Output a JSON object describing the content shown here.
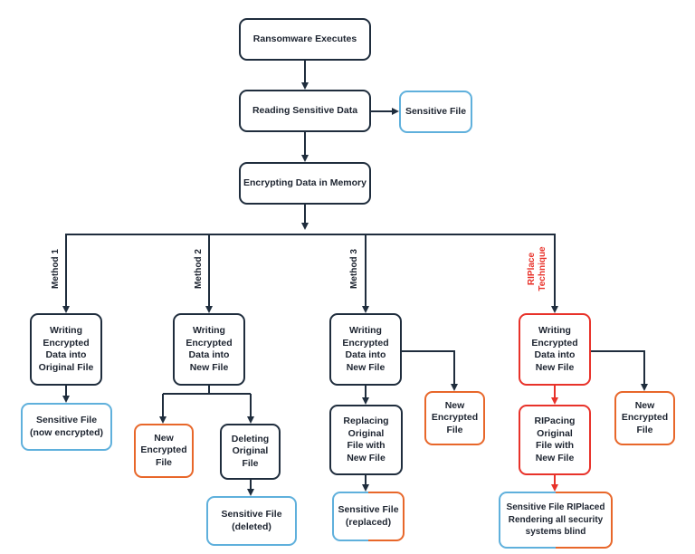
{
  "colors": {
    "dark": "#1f2d3d",
    "blue": "#5fb0dc",
    "orange": "#e8672a",
    "red": "#e8322a"
  },
  "top": {
    "ransomware_executes": "Ransomware Executes",
    "reading_sensitive_data": "Reading Sensitive Data",
    "sensitive_file": "Sensitive File",
    "encrypting_data": "Encrypting Data in Memory"
  },
  "branches": {
    "method1": {
      "label": "Method 1"
    },
    "method2": {
      "label": "Method 2"
    },
    "method3": {
      "label": "Method 3"
    },
    "riplace": {
      "label": "RIPlace\nTechnique"
    }
  },
  "method1": {
    "write": "Writing\nEncrypted\nData into\nOriginal File",
    "result": "Sensitive File\n(now encrypted)"
  },
  "method2": {
    "write": "Writing\nEncrypted\nData into\nNew File",
    "new_file": "New\nEncrypted\nFile",
    "delete": "Deleting\nOriginal\nFile",
    "result": "Sensitive File\n(deleted)"
  },
  "method3": {
    "write": "Writing\nEncrypted\nData into\nNew File",
    "new_file": "New\nEncrypted\nFile",
    "replace": "Replacing\nOriginal\nFile with\nNew File",
    "result": "Sensitive File\n(replaced)"
  },
  "riplace": {
    "write": "Writing\nEncrypted\nData into\nNew File",
    "new_file": "New\nEncrypted\nFile",
    "replace": "RIPacing\nOriginal\nFile with\nNew File",
    "result": "Sensitive File RIPlaced\nRendering all security\nsystems blind"
  }
}
